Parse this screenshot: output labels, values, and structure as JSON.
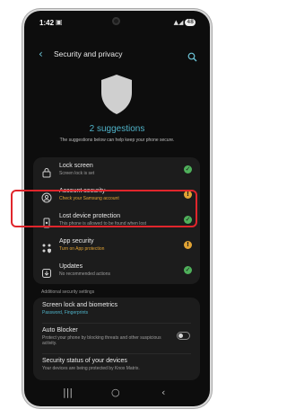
{
  "status_bar": {
    "time": "1:42",
    "notif": "▣",
    "signal": "▲◢",
    "battery": "48"
  },
  "header": {
    "title": "Security and privacy"
  },
  "hero": {
    "headline": "2 suggestions",
    "sub": "The suggestions below can help keep your phone secure."
  },
  "items": [
    {
      "name": "Lock screen",
      "desc": "Screen lock is set",
      "status": "ok",
      "icon": "lock-icon"
    },
    {
      "name": "Account security",
      "desc": "Check your Samsung account",
      "status": "warning",
      "icon": "account-icon"
    },
    {
      "name": "Lost device protection",
      "desc": "This phone is allowed to be found when lost",
      "status": "ok",
      "icon": "find-device-icon"
    },
    {
      "name": "App security",
      "desc": "Turn on App protection",
      "status": "warning",
      "icon": "app-security-icon"
    },
    {
      "name": "Updates",
      "desc": "No recommended actions",
      "status": "ok",
      "icon": "updates-icon"
    }
  ],
  "additional": {
    "label": "Additional security settings",
    "lock_biometrics": {
      "name": "Screen lock and biometrics",
      "desc": "Password, Fingerprints"
    },
    "auto_blocker": {
      "name": "Auto Blocker",
      "desc": "Protect your phone by blocking threats and other suspicious activity.",
      "enabled": false
    },
    "device_status": {
      "name": "Security status of your devices",
      "desc": "Your devices are being protected by Knox Matrix."
    }
  },
  "colors": {
    "accent": "#4fb3c9",
    "ok": "#4fb05b",
    "warning": "#e1a334",
    "highlight": "#e0262c",
    "desc_ok": "#9e9e9e",
    "desc_warn": "#e1a334",
    "desc_link": "#4fb3c9"
  }
}
